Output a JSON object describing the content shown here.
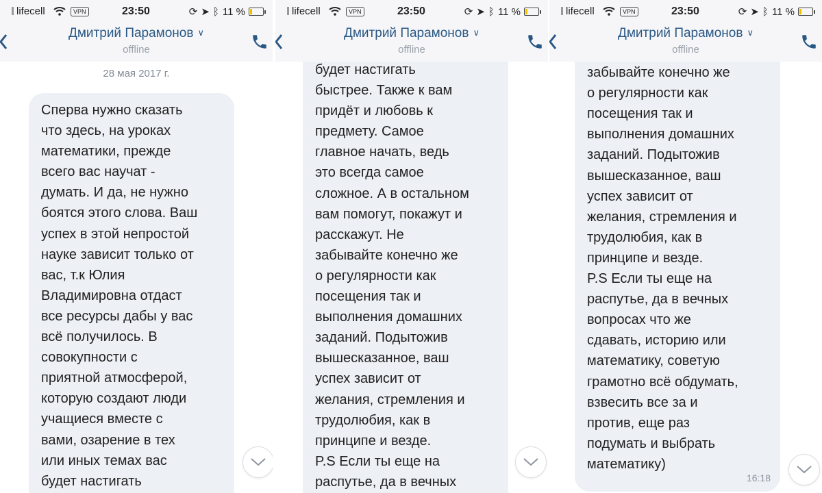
{
  "colors": {
    "accent": "#2a5885",
    "bubble_bg": "#edf0f5",
    "header_bg": "#f6f6f8",
    "status_muted": "#9aa1ab",
    "battery": "#f0c000"
  },
  "status_bar": {
    "carrier": "lifecell",
    "vpn": "VPN",
    "time": "23:50",
    "battery": "11 %"
  },
  "header": {
    "contact_name": "Дмитрий Парамонов",
    "contact_status": "offline"
  },
  "panels": [
    {
      "date_separator": "28 мая 2017 г.",
      "message_text": "Сперва нужно сказать\nчто здесь, на уроках\nматематики, прежде\nвсего вас научат -\nдумать. И да, не нужно\nбоятся этого слова. Ваш\nуспех в этой непростой\nнауке зависит только от\nвас, т.к Юлия\nВладимировна отдаст\nвсе ресурсы дабы у вас\nвсё получилось. В\nсовокупности с\nприятной атмосферой,\nкоторую создают люди\nучащиеся вместе с\nвами, озарение в тех\nили иных темах вас\nбудет настигать"
    },
    {
      "message_text": "будет настигать\nбыстрее. Также к вам\nпридёт и любовь к\nпредмету. Самое\nглавное начать, ведь\nэто всегда самое\nсложное. А в остальном\nвам помогут, покажут и\nрасскажут. Не\nзабывайте конечно же\nо регулярности как\nпосещения так и\nвыполнения домашних\nзаданий. Подытожив\nвышесказанное, ваш\nуспех зависит от\nжелания, стремления и\nтрудолюбия, как в\nпринципе и везде.\nP.S Если ты еще на\nраспутье, да в вечных"
    },
    {
      "message_text": "расскажут. Не\nзабывайте конечно же\nо регулярности как\nпосещения так и\nвыполнения домашних\nзаданий. Подытожив\nвышесказанное, ваш\nуспех зависит от\nжелания, стремления и\nтрудолюбия, как в\nпринципе и везде.\nP.S Если ты еще на\nраспутье, да в вечных\nвопросах что же\nсдавать, историю или\nматематику, советую\nгр(a)мотно всё обдумать,\nвзвесить все за и\nпротив, еще раз\nподумать и выбрать\nматематику)",
      "message_time": "16:18"
    }
  ]
}
